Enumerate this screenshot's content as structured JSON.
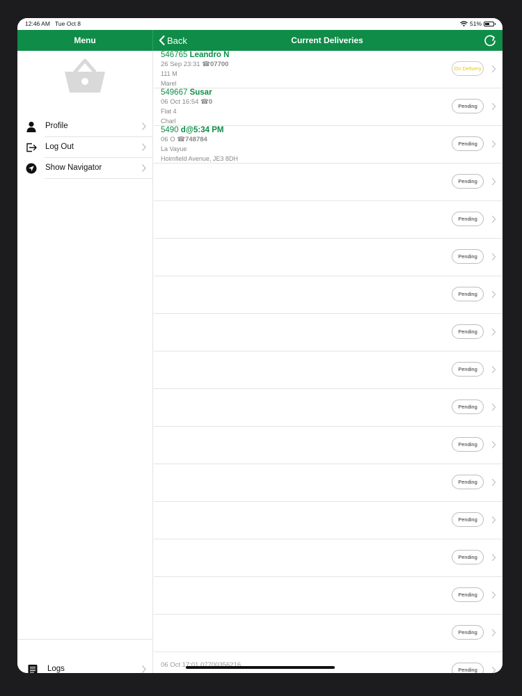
{
  "status_bar": {
    "time": "12:46 AM",
    "date": "Tue Oct 8",
    "battery": "51%",
    "battery_level": 0.51
  },
  "sidebar": {
    "title": "Menu",
    "items": [
      {
        "label": "Profile",
        "icon": "person-icon"
      },
      {
        "label": "Log Out",
        "icon": "logout-icon"
      },
      {
        "label": "Show Navigator",
        "icon": "navigation-arrow-icon"
      }
    ],
    "logs_label": "Logs"
  },
  "header": {
    "back_label": "Back",
    "title": "Current Deliveries"
  },
  "orders": [
    {
      "id": "546765",
      "name": "Leandro N",
      "date": "26 Sep 23:31",
      "phone": "07700",
      "addr1": "111 M",
      "addr2": "Marel",
      "status": "On Delivery"
    },
    {
      "id": "549667",
      "name": "Susar",
      "date": "06 Oct 16:54",
      "phone": "0",
      "addr1": "Flat 4",
      "addr2": "Charl",
      "status": "Pending"
    },
    {
      "id": "5490",
      "name": "d@5:34 PM",
      "date": "06 O",
      "phone": "748784",
      "addr1": "La Vayue",
      "addr2": "Holmfield Avenue, JE3 8DH",
      "status": "Pending"
    },
    {
      "status": "Pending"
    },
    {
      "status": "Pending"
    },
    {
      "status": "Pending"
    },
    {
      "status": "Pending"
    },
    {
      "status": "Pending"
    },
    {
      "status": "Pending"
    },
    {
      "status": "Pending"
    },
    {
      "status": "Pending"
    },
    {
      "status": "Pending"
    },
    {
      "status": "Pending"
    },
    {
      "status": "Pending"
    },
    {
      "status": "Pending"
    },
    {
      "status": "Pending"
    },
    {
      "status": "Pending"
    }
  ],
  "bottom_ghost": "06 Oct 17:01 07700356216",
  "colors": {
    "brand_green": "#0f8c48",
    "on_delivery": "#f0c419"
  }
}
